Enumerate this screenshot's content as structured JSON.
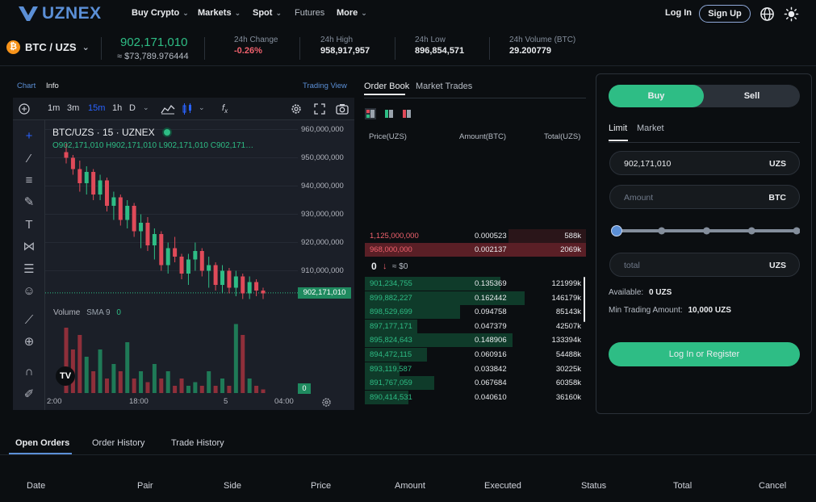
{
  "brand": {
    "name": "UZNEX"
  },
  "nav": {
    "items": [
      {
        "label": "Buy Crypto",
        "has_dropdown": true
      },
      {
        "label": "Markets",
        "has_dropdown": true
      },
      {
        "label": "Spot",
        "has_dropdown": true
      },
      {
        "label": "Futures",
        "has_dropdown": false
      },
      {
        "label": "More",
        "has_dropdown": true
      }
    ],
    "login": "Log In",
    "signup": "Sign Up"
  },
  "ticker": {
    "pair": "BTC / UZS",
    "coin_glyph": "₿",
    "last_price": "902,171,010",
    "last_usd": "≈ $73,789.976444",
    "change_label": "24h Change",
    "change_value": "-0.26%",
    "high_label": "24h High",
    "high_value": "958,917,957",
    "low_label": "24h Low",
    "low_value": "896,854,571",
    "volume_label": "24h Volume (BTC)",
    "volume_value": "29.200779"
  },
  "chart_tabs": {
    "chart": "Chart",
    "info": "Info",
    "trading_view": "Trading View"
  },
  "chart_toolbar": {
    "intervals": [
      "1m",
      "3m",
      "15m",
      "1h",
      "D"
    ],
    "active_interval": "15m"
  },
  "chart_legend": {
    "title": "BTC/UZS · 15 · UZNEX",
    "ohlc": "O902,171,010  H902,171,010  L902,171,010  C902,171…",
    "volume": "Volume",
    "sma": "SMA 9",
    "sma_value": "0",
    "vol_badge": "0"
  },
  "chart_data": {
    "type": "candlestick",
    "y_ticks": [
      "960,000,000",
      "950,000,000",
      "940,000,000",
      "930,000,000",
      "920,000,000",
      "910,000,000"
    ],
    "y_range": [
      900000000,
      960000000
    ],
    "current_price": 902171010,
    "current_price_label": "902,171,010",
    "x_ticks": [
      "2:00",
      "18:00",
      "5",
      "04:00"
    ],
    "colors": {
      "up": "#2ebd85",
      "down": "#e04a59"
    },
    "candles": [
      [
        952,
        955,
        948,
        950
      ],
      [
        950,
        951,
        944,
        946
      ],
      [
        946,
        949,
        938,
        941
      ],
      [
        941,
        947,
        937,
        945
      ],
      [
        945,
        946,
        935,
        937
      ],
      [
        937,
        944,
        935,
        942
      ],
      [
        942,
        943,
        931,
        933
      ],
      [
        933,
        938,
        928,
        936
      ],
      [
        936,
        937,
        926,
        928
      ],
      [
        928,
        935,
        925,
        933
      ],
      [
        933,
        934,
        922,
        924
      ],
      [
        924,
        930,
        918,
        927
      ],
      [
        927,
        929,
        917,
        919
      ],
      [
        919,
        925,
        914,
        923
      ],
      [
        923,
        924,
        910,
        912
      ],
      [
        912,
        920,
        909,
        918
      ],
      [
        918,
        922,
        913,
        915
      ],
      [
        915,
        916,
        907,
        909
      ],
      [
        909,
        916,
        905,
        914
      ],
      [
        914,
        920,
        910,
        917
      ],
      [
        917,
        918,
        908,
        910
      ],
      [
        910,
        915,
        904,
        912
      ],
      [
        912,
        913,
        903,
        905
      ],
      [
        905,
        912,
        902,
        910
      ],
      [
        910,
        911,
        902,
        904
      ],
      [
        904,
        910,
        901,
        908
      ],
      [
        908,
        909,
        900,
        902
      ],
      [
        902,
        908,
        900,
        906
      ],
      [
        906,
        907,
        901,
        903
      ],
      [
        903,
        904,
        900,
        902
      ]
    ],
    "volumes": [
      0.9,
      0.6,
      0.8,
      0.5,
      0.3,
      0.6,
      0.2,
      0.4,
      0.3,
      0.7,
      0.2,
      0.3,
      0.15,
      0.4,
      0.2,
      0.3,
      0.1,
      0.2,
      0.1,
      0.15,
      0.1,
      0.3,
      0.1,
      0.2,
      0.1,
      0.95,
      0.8,
      0.2,
      0.1,
      0.05
    ]
  },
  "orderbook": {
    "tabs": [
      "Order Book",
      "Market Trades"
    ],
    "headers": {
      "price": "Price(UZS)",
      "amount": "Amount(BTC)",
      "total": "Total(UZS)"
    },
    "asks": [
      {
        "price": "1,125,000,000",
        "amount": "0.000523",
        "total": "588k",
        "depth": 0.35
      },
      {
        "price": "968,000,000",
        "amount": "0.002137",
        "total": "2069k",
        "depth": 1.0
      }
    ],
    "mid": {
      "price": "0",
      "arrow": "↓",
      "usd": "≈ $0"
    },
    "bids": [
      {
        "price": "901,234,755",
        "amount": "0.135369",
        "total": "121999k",
        "depth": 0.78
      },
      {
        "price": "899,882,227",
        "amount": "0.162442",
        "total": "146179k",
        "depth": 0.92
      },
      {
        "price": "898,529,699",
        "amount": "0.094758",
        "total": "85143k",
        "depth": 0.55
      },
      {
        "price": "897,177,171",
        "amount": "0.047379",
        "total": "42507k",
        "depth": 0.3
      },
      {
        "price": "895,824,643",
        "amount": "0.148906",
        "total": "133394k",
        "depth": 0.85
      },
      {
        "price": "894,472,115",
        "amount": "0.060916",
        "total": "54488k",
        "depth": 0.36
      },
      {
        "price": "893,119,587",
        "amount": "0.033842",
        "total": "30225k",
        "depth": 0.2
      },
      {
        "price": "891,767,059",
        "amount": "0.067684",
        "total": "60358k",
        "depth": 0.4
      },
      {
        "price": "890,414,531",
        "amount": "0.040610",
        "total": "36160k",
        "depth": 0.25
      }
    ]
  },
  "trade": {
    "buy": "Buy",
    "sell": "Sell",
    "order_types": [
      "Limit",
      "Market"
    ],
    "price_value": "902,171,010",
    "price_unit": "UZS",
    "amount_placeholder": "Amount",
    "amount_unit": "BTC",
    "slider_percent": 0,
    "total_placeholder": "total",
    "total_unit": "UZS",
    "available_label": "Available:",
    "available_value": "0 UZS",
    "min_label": "Min Trading Amount:",
    "min_value": "10,000 UZS",
    "cta": "Log In or Register"
  },
  "bottom": {
    "tabs": [
      "Open Orders",
      "Order History",
      "Trade History"
    ],
    "columns": [
      "Date",
      "Pair",
      "Side",
      "Price",
      "Amount",
      "Executed",
      "Status",
      "Total",
      "Cancel"
    ]
  },
  "colors": {
    "accent": "#2ebd85",
    "down": "#e04a59",
    "brand": "#5b8fd6"
  }
}
